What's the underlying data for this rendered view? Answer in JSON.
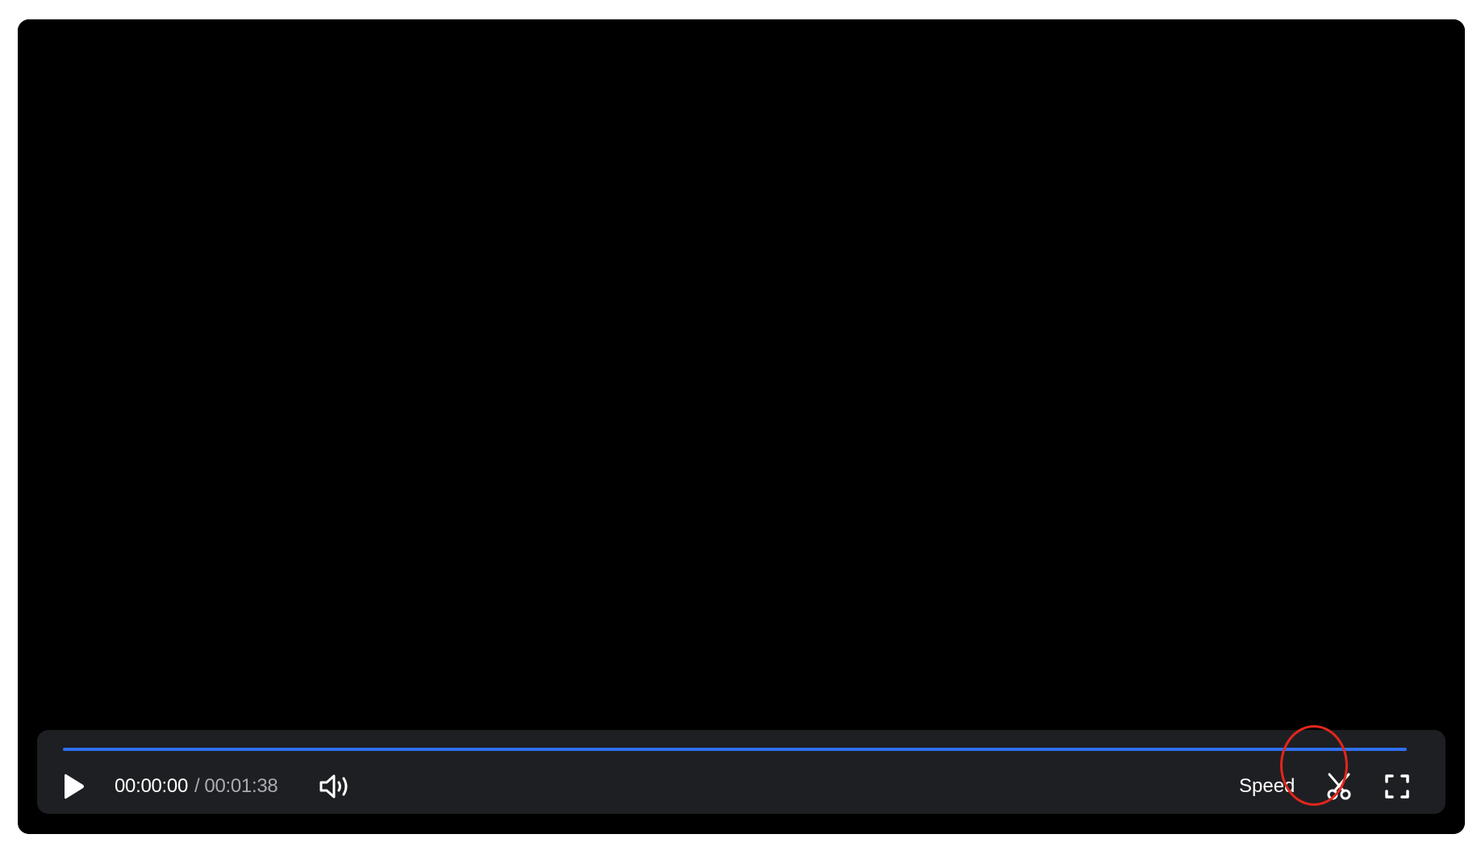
{
  "player": {
    "current_time": "00:00:00",
    "separator": "/",
    "duration": "00:01:38",
    "progress": 0.0,
    "speed_label": "Speed"
  },
  "icons": {
    "play": "play-icon",
    "volume": "volume-icon",
    "clip": "scissors-icon",
    "fullscreen": "fullscreen-icon"
  },
  "colors": {
    "accent": "#2f6fed",
    "highlight": "#e3261c",
    "control_bar": "#1e1f23"
  }
}
